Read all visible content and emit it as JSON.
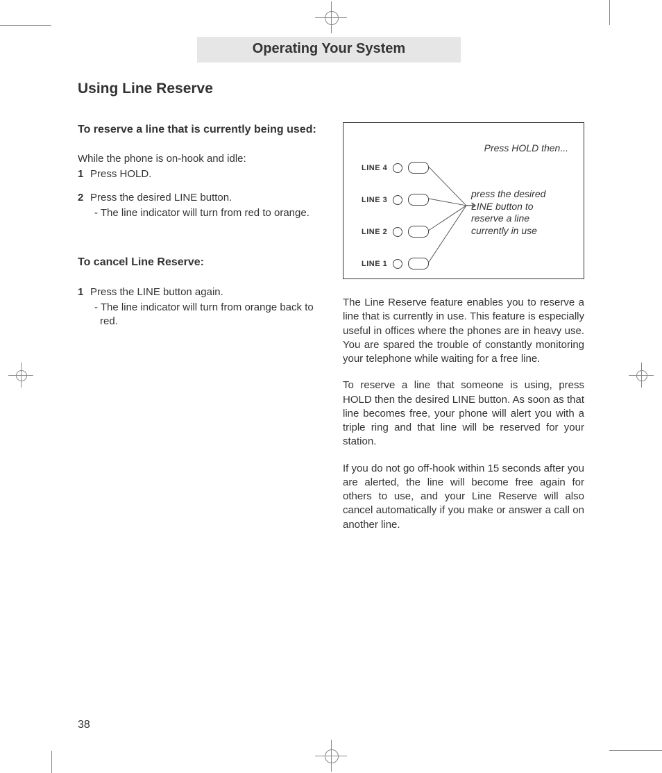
{
  "header": {
    "title": "Operating Your System"
  },
  "section": {
    "title": "Using Line Reserve"
  },
  "left": {
    "sub1": "To reserve a line that is currently being used:",
    "lead": "While the phone is on-hook and idle:",
    "step1_num": "1",
    "step1_text": "Press HOLD.",
    "step2_num": "2",
    "step2_text": "Press the desired LINE button.",
    "step2_bullet": "- The line indicator will turn from red to orange.",
    "sub2": "To cancel Line Reserve:",
    "cancel1_num": "1",
    "cancel1_text": "Press the LINE button again.",
    "cancel1_bullet": "- The line indicator will turn from orange back to red."
  },
  "diagram": {
    "top_caption": "Press HOLD then...",
    "side_caption": "press the desired LINE button to reserve a line currently in use",
    "lines": {
      "l4": "LINE 4",
      "l3": "LINE 3",
      "l2": "LINE 2",
      "l1": "LINE 1"
    }
  },
  "right": {
    "p1": "The Line Reserve feature enables you to reserve a line that is currently in use.  This feature is especially useful in offices where the phones are in heavy use.  You are spared the trouble of constantly monitoring your telephone while waiting for a free line.",
    "p2": "To reserve a line that someone is using, press HOLD then the desired LINE button.  As soon as that line becomes free, your phone will alert you with a triple ring and that line will be reserved for your station.",
    "p3": "If you do not go off-hook within 15 seconds after you are alerted, the line will become free again for others to use, and your Line Reserve will also cancel automatically if you make or answer a call on another line."
  },
  "page_number": "38"
}
